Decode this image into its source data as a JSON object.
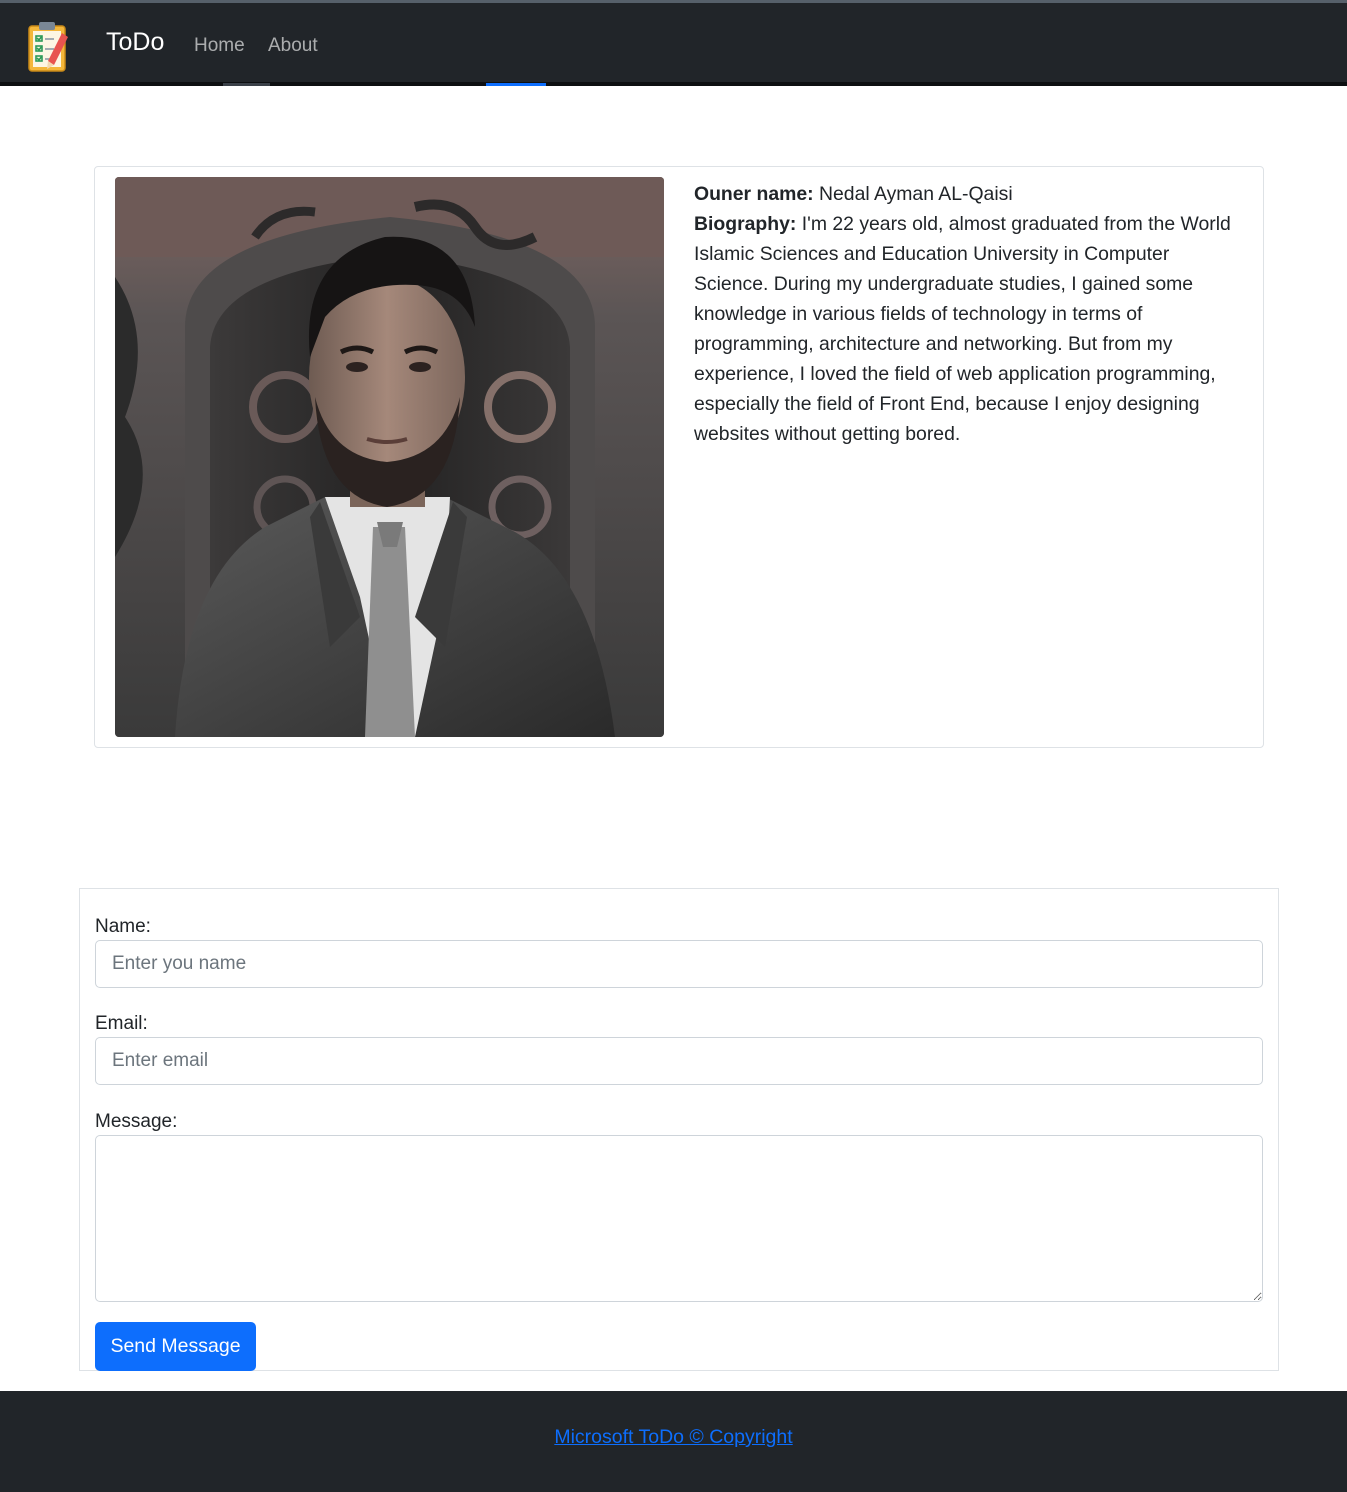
{
  "navbar": {
    "brand": "ToDo",
    "links": [
      {
        "label": "Home"
      },
      {
        "label": "About"
      }
    ],
    "logo_icon": "clipboard-checklist-icon"
  },
  "profile": {
    "photo_icon": "portrait-photo",
    "owner_label": "Ouner name:",
    "owner_name": "Nedal Ayman AL-Qaisi",
    "bio_label": "Biography:",
    "bio_text": "I'm 22 years old, almost graduated from the World Islamic Sciences and Education University in Computer Science. During my undergraduate studies, I gained some knowledge in various fields of technology in terms of programming, architecture and networking. But from my experience, I loved the field of web application programming, especially the field of Front End, because I enjoy designing websites without getting bored."
  },
  "form": {
    "name_label": "Name:",
    "name_placeholder": "Enter you name",
    "name_value": "",
    "email_label": "Email:",
    "email_placeholder": "Enter email",
    "email_value": "",
    "message_label": "Message:",
    "message_value": "",
    "submit_label": "Send Message"
  },
  "footer": {
    "link_text": "Microsoft ToDo © Copyright"
  },
  "colors": {
    "navbar_bg": "#212529",
    "primary": "#0d6efd",
    "text": "#212529",
    "border": "#dee2e6"
  }
}
